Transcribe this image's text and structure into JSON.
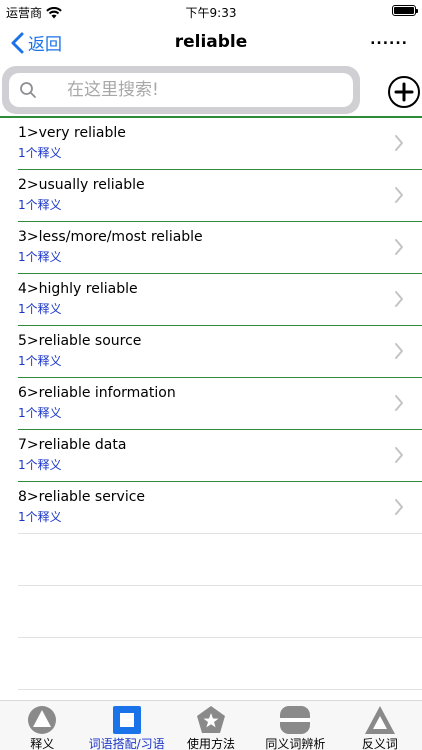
{
  "status_bar": {
    "carrier": "运营商",
    "time": "下午9:33"
  },
  "nav": {
    "back_label": "返回",
    "title": "reliable",
    "more_label": "......"
  },
  "search": {
    "placeholder": "在这里搜索!"
  },
  "list": {
    "items": [
      {
        "term": "1>very reliable",
        "sub": "1个释义"
      },
      {
        "term": "2>usually reliable",
        "sub": "1个释义"
      },
      {
        "term": "3>less/more/most reliable",
        "sub": "1个释义"
      },
      {
        "term": "4>highly reliable",
        "sub": "1个释义"
      },
      {
        "term": "5>reliable source",
        "sub": "1个释义"
      },
      {
        "term": "6>reliable information",
        "sub": "1个释义"
      },
      {
        "term": "7>reliable data",
        "sub": "1个释义"
      },
      {
        "term": "8>reliable service",
        "sub": "1个释义"
      }
    ]
  },
  "tabs": [
    {
      "label": "释义",
      "icon": "circle-triangle-icon",
      "active": false
    },
    {
      "label": "词语搭配/习语",
      "icon": "square-icon",
      "active": true
    },
    {
      "label": "使用方法",
      "icon": "pentagon-star-icon",
      "active": false
    },
    {
      "label": "同义词辨析",
      "icon": "rounded-bars-icon",
      "active": false
    },
    {
      "label": "反义词",
      "icon": "triangle-icon",
      "active": false
    }
  ],
  "colors": {
    "accent": "#1a73e8",
    "divider": "#2e8b3a",
    "sub_text": "#1a35c9",
    "tab_icon_gray": "#8a8a8a"
  }
}
